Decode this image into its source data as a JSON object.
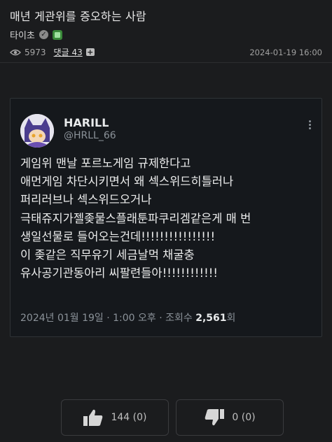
{
  "post": {
    "title": "매년 게관위를 증오하는 사람",
    "author": "타이초",
    "views": "5973",
    "comments_label": "댓글 43",
    "timestamp": "2024-01-19 16:00"
  },
  "tweet": {
    "display_name": "HARILL",
    "handle": "@HRLL_66",
    "lines": [
      "게임위 맨날 포르노게임 규제한다고",
      "애먼게임 차단시키면서 왜 섹스위드히틀러나",
      "퍼리러브나 섹스위드오거나",
      "극태쥬지가젤좆물스플래툰파쿠리겜같은게 매 번",
      "생일선물로 들어오는건데!!!!!!!!!!!!!!!!",
      "이 좆같은 직무유기 세금날먹 채굴충",
      "유사공기관동아리 씨팔련들아!!!!!!!!!!!!"
    ],
    "date": "2024년 01월 19일 · 1:00 오후 · 조회수 ",
    "views_count": "2,561",
    "views_suffix": "회"
  },
  "votes": {
    "like_label": "144 (0)",
    "dislike_label": "0 (0)"
  },
  "icons": {
    "eye": "eye-icon",
    "plus": "plus-icon",
    "verified": "verified-icon",
    "badge": "level-badge-icon",
    "thumbs_up": "thumbs-up-icon",
    "thumbs_down": "thumbs-down-icon",
    "more": "more-options-icon"
  },
  "colors": {
    "background": "#1b1c1e",
    "card": "#15181c",
    "badge": "#3a8a3a"
  }
}
